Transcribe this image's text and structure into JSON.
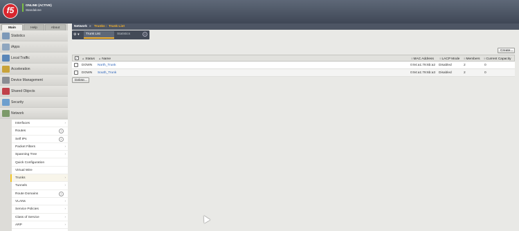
{
  "header": {
    "logo_text": "f5",
    "status_line1": "ONLINE (ACTIVE)",
    "status_line2": "Standalone"
  },
  "top_tabs": [
    {
      "label": "Main"
    },
    {
      "label": "Help"
    },
    {
      "label": "About"
    }
  ],
  "breadcrumb": {
    "section": "Network",
    "arrow": "»",
    "page": "Trunks",
    "sep": ":",
    "view": "Trunk List"
  },
  "sub_tabs": {
    "gear": "⚙ ▾",
    "items": [
      {
        "label": "Trunk List"
      },
      {
        "label": "Statistics"
      }
    ],
    "add": "+"
  },
  "sidebar": {
    "items": [
      {
        "label": "Statistics",
        "icon": "statistics-icon"
      },
      {
        "label": "iApps",
        "icon": "iapps-icon"
      },
      {
        "label": "Local Traffic",
        "icon": "local-traffic-icon"
      },
      {
        "label": "Acceleration",
        "icon": "acceleration-icon"
      },
      {
        "label": "Device Management",
        "icon": "device-management-icon"
      },
      {
        "label": "Shared Objects",
        "icon": "shared-objects-icon"
      },
      {
        "label": "Security",
        "icon": "security-icon"
      },
      {
        "label": "Network",
        "icon": "network-icon"
      }
    ],
    "network_submenu": [
      {
        "label": "Interfaces",
        "arrow": "›"
      },
      {
        "label": "Routes",
        "add": "+"
      },
      {
        "label": "Self IPs",
        "add": "+"
      },
      {
        "label": "Packet Filters",
        "arrow": "›"
      },
      {
        "label": "Spanning Tree",
        "arrow": "›"
      },
      {
        "label": "Quick Configuration"
      },
      {
        "label": "Virtual Wire"
      },
      {
        "label": "Trunks",
        "arrow": "›"
      },
      {
        "label": "Tunnels",
        "arrow": "›"
      },
      {
        "label": "Route Domains",
        "add": "+"
      },
      {
        "label": "VLANs",
        "arrow": "›"
      },
      {
        "label": "Service Policies",
        "arrow": "›"
      },
      {
        "label": "Class of Service",
        "arrow": "›"
      },
      {
        "label": "ARP",
        "arrow": "›"
      }
    ]
  },
  "toolbar": {
    "create_label": "Create...",
    "delete_label": "Delete..."
  },
  "table": {
    "columns": {
      "check": "✓",
      "status": "Status",
      "name": "Name",
      "mac": "MAC Address",
      "lacp": "LACP Mode",
      "members": "Members",
      "capacity": "Current Capacity",
      "sort_icon": "▲",
      "col_icon": "≡"
    },
    "rows": [
      {
        "status": "DOWN",
        "name": "North_Trunk",
        "mac": "0:94:a1:78:6b:a2",
        "lacp": "Disabled",
        "members": "2",
        "capacity": "0"
      },
      {
        "status": "DOWN",
        "name": "South_Trunk",
        "mac": "0:94:a1:78:6b:a3",
        "lacp": "Disabled",
        "members": "2",
        "capacity": "0"
      }
    ]
  },
  "colors": {
    "accent": "#f6b32b",
    "header": "#4d5564",
    "link": "#2a62b8",
    "status_online": "#7bc043"
  }
}
